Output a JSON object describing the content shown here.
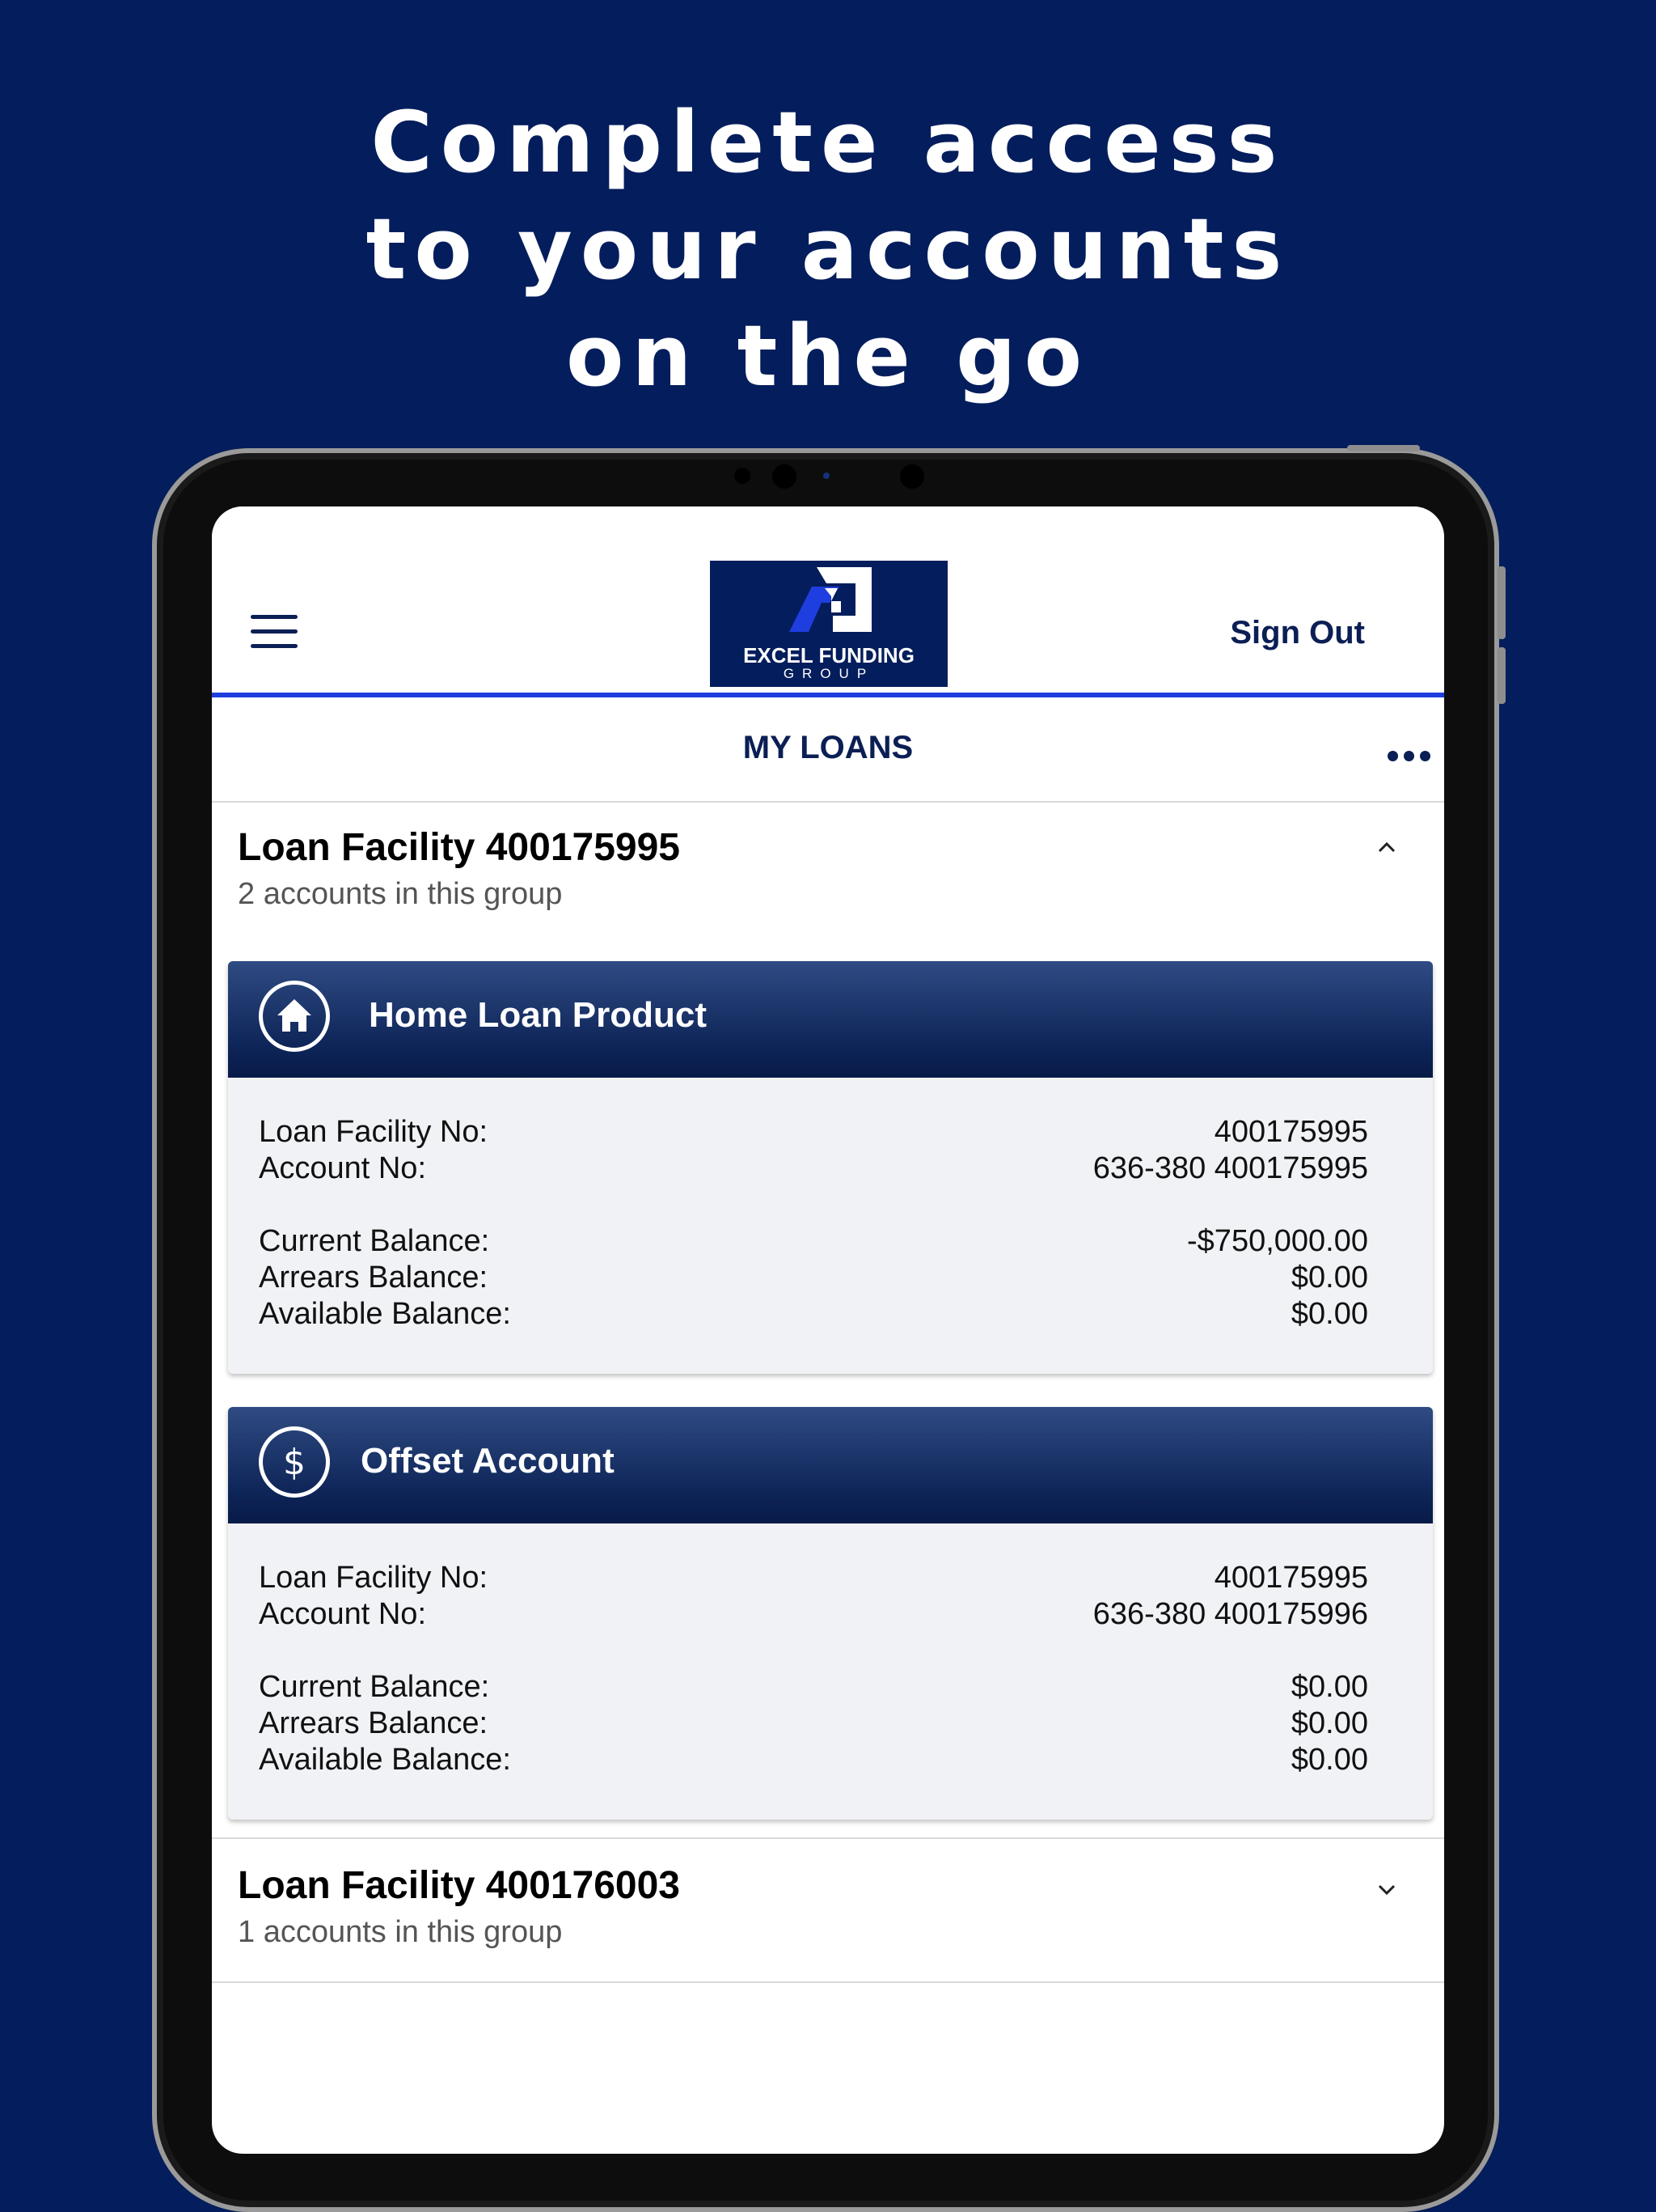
{
  "headline": [
    "Complete access",
    "to your accounts",
    "on the go"
  ],
  "header": {
    "logo_text": "EXCEL FUNDING",
    "logo_sub": "GROUP",
    "sign_out": "Sign Out"
  },
  "page_title": "MY LOANS",
  "groups": [
    {
      "title": "Loan Facility 400175995",
      "subtitle": "2 accounts in this group",
      "expanded": true,
      "accounts": [
        {
          "name": "Home Loan Product",
          "icon": "home-icon",
          "rows": [
            {
              "label": "Loan Facility No:",
              "value": "400175995"
            },
            {
              "label": "Account No:",
              "value": "636-380 400175995"
            },
            {
              "label": "Current Balance:",
              "value": "-$750,000.00"
            },
            {
              "label": "Arrears Balance:",
              "value": "$0.00"
            },
            {
              "label": "Available Balance:",
              "value": "$0.00"
            }
          ]
        },
        {
          "name": "Offset Account",
          "icon": "dollar-icon",
          "rows": [
            {
              "label": "Loan Facility No:",
              "value": "400175995"
            },
            {
              "label": "Account No:",
              "value": "636-380 400175996"
            },
            {
              "label": "Current Balance:",
              "value": "$0.00"
            },
            {
              "label": "Arrears Balance:",
              "value": "$0.00"
            },
            {
              "label": "Available Balance:",
              "value": "$0.00"
            }
          ]
        }
      ]
    },
    {
      "title": "Loan Facility 400176003",
      "subtitle": "1 accounts in this group",
      "expanded": false
    }
  ],
  "colors": {
    "background": "#041d5c",
    "accent_line": "#1f3ee0",
    "text_dark": "#0b1f55",
    "card_bg": "#f1f2f6"
  }
}
